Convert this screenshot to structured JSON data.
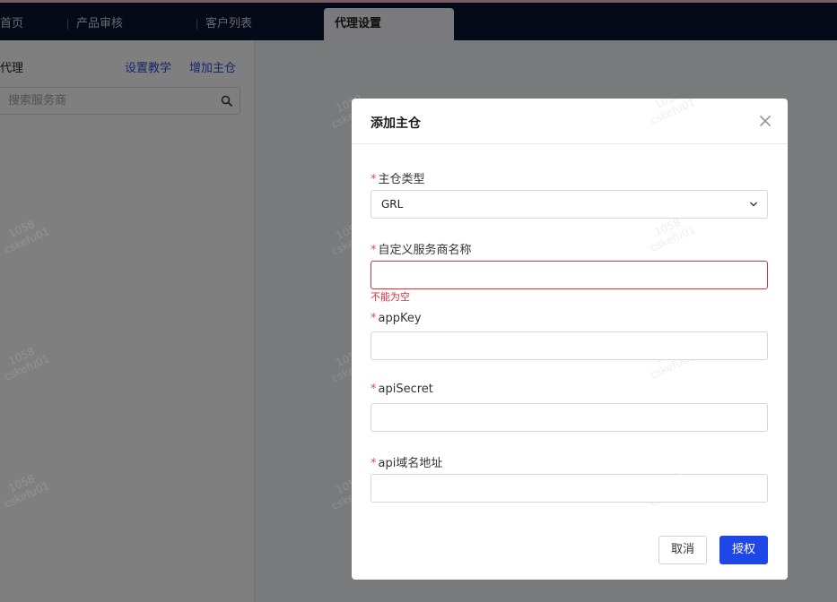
{
  "nav": {
    "tabs": [
      {
        "label": "首页"
      },
      {
        "label": "产品审核"
      },
      {
        "label": "客户列表"
      },
      {
        "label": "代理设置"
      }
    ]
  },
  "left_panel": {
    "title": "代理",
    "link_tutorial": "设置教学",
    "link_add_warehouse": "增加主仓",
    "search_placeholder": "搜索服务商",
    "search_icon": "search-icon"
  },
  "watermark": {
    "id": "1058",
    "user": "cskefu01"
  },
  "modal": {
    "title": "添加主仓",
    "required_mark": "*",
    "fields": {
      "warehouse_type": {
        "label": "主仓类型",
        "value": "GRL"
      },
      "custom_name": {
        "label": "自定义服务商名称",
        "value": "",
        "error": "不能为空"
      },
      "app_key": {
        "label": "appKey",
        "value": ""
      },
      "api_secret": {
        "label": "apiSecret",
        "value": ""
      },
      "api_domain": {
        "label": "api域名地址",
        "value": ""
      }
    },
    "buttons": {
      "cancel": "取消",
      "authorize": "授权"
    }
  },
  "colors": {
    "nav_bg": "#0b1530",
    "accent_blue": "#1f46e6",
    "link_blue": "#2a4ed8",
    "error_red": "#d9303e",
    "required_red": "#e34d4d"
  }
}
